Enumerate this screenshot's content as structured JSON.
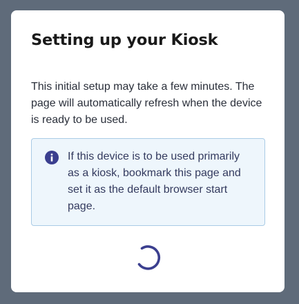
{
  "dialog": {
    "title": "Setting up your Kiosk",
    "description": "This initial setup may take a few minutes. The page will automatically refresh when the device is ready to be used.",
    "info": {
      "icon": "info-circle-icon",
      "text": "If this device is to be used primarily as a kiosk, bookmark this page and set it as the default browser start page."
    },
    "spinner": {
      "icon": "loading-spinner-icon"
    }
  },
  "colors": {
    "backdrop": "#5f6b7a",
    "card": "#ffffff",
    "title_text": "#1a1a1a",
    "body_text": "#2a2f3a",
    "info_background": "#eef6fc",
    "info_border": "#a9cbe6",
    "info_icon": "#3b3f8f",
    "spinner": "#3b3f8f"
  }
}
